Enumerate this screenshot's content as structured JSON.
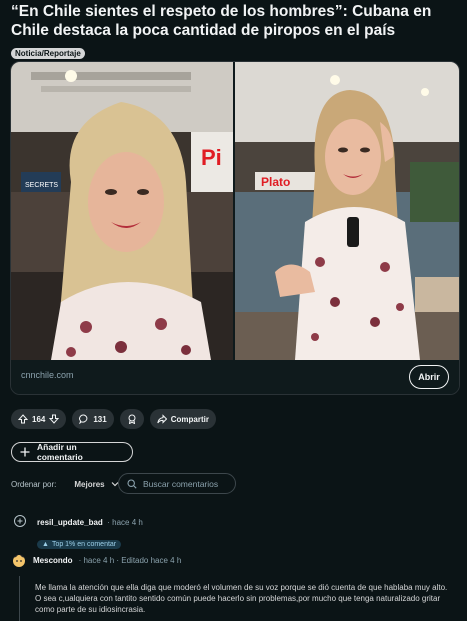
{
  "post": {
    "title": "“En Chile sientes el respeto de los hombres”: Cubana en Chile destaca la poca cantidad de piropos en el país",
    "flair": "Noticia/Reportaje",
    "domain": "cnnchile.com",
    "open_label": "Abrir",
    "media": {
      "left_sign": "Pi",
      "right_sign": "Plato",
      "store_sign": "SECRETS"
    }
  },
  "actions": {
    "votes": "164",
    "comments": "131",
    "share_label": "Compartir"
  },
  "add_comment_label": "Añadir un comentario",
  "sort": {
    "label": "Ordenar por:",
    "value": "Mejores"
  },
  "search": {
    "placeholder": "Buscar comentarios"
  },
  "comments": [
    {
      "author": "resil_update_bad",
      "meta": "· hace 4 h",
      "badge": "Top 1% en comentar"
    },
    {
      "author": "Mescondo",
      "meta": "· hace 4 h · Editado hace 4 h",
      "body": "Me llama la atención que ella diga que moderó el volumen de su voz porque se dió cuenta de que hablaba muy alto. O sea c,ualquiera con tantito sentido común puede hacerlo sin problemas,por mucho que tenga naturalizado gritar como parte de su idiosincrasia."
    }
  ]
}
